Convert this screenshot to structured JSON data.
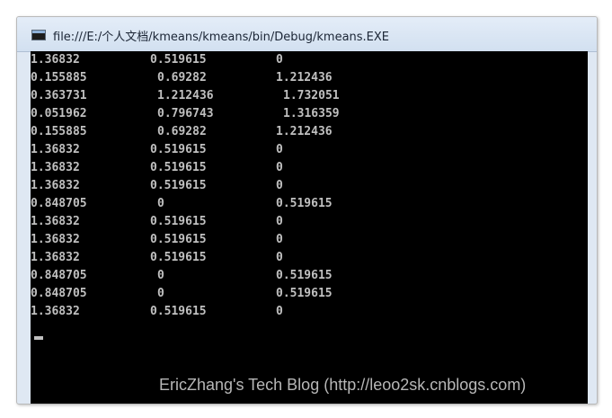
{
  "window": {
    "title": "file:///E:/个人文档/kmeans/kmeans/bin/Debug/kmeans.EXE",
    "icon": "console-window-icon"
  },
  "console": {
    "rows": [
      {
        "cells": [
          "1.36832",
          "0.519615",
          "0"
        ]
      },
      {
        "cells": [
          "0.155885",
          "0.69282",
          "1.212436"
        ]
      },
      {
        "cells": [
          "0.363731",
          "1.212436",
          "1.732051"
        ]
      },
      {
        "cells": [
          "0.051962",
          "0.796743",
          "1.316359"
        ]
      },
      {
        "cells": [
          "0.155885",
          "0.69282",
          "1.212436"
        ]
      },
      {
        "cells": [
          "1.36832",
          "0.519615",
          "0"
        ]
      },
      {
        "cells": [
          "1.36832",
          "0.519615",
          "0"
        ]
      },
      {
        "cells": [
          "1.36832",
          "0.519615",
          "0"
        ]
      },
      {
        "cells": [
          "0.848705",
          "0",
          "0.519615"
        ]
      },
      {
        "cells": [
          "1.36832",
          "0.519615",
          "0"
        ]
      },
      {
        "cells": [
          "1.36832",
          "0.519615",
          "0"
        ]
      },
      {
        "cells": [
          "1.36832",
          "0.519615",
          "0"
        ]
      },
      {
        "cells": [
          "0.848705",
          "0",
          "0.519615"
        ]
      },
      {
        "cells": [
          "0.848705",
          "0",
          "0.519615"
        ]
      },
      {
        "cells": [
          "1.36832",
          "0.519615",
          "0"
        ]
      }
    ]
  },
  "watermark": "EricZhang's Tech Blog (http://leoo2sk.cnblogs.com)"
}
